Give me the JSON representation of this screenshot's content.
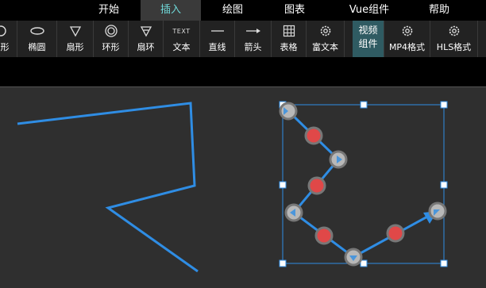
{
  "menu": {
    "tabs": [
      {
        "label": "开始"
      },
      {
        "label": "插入"
      },
      {
        "label": "绘图"
      },
      {
        "label": "图表"
      },
      {
        "label": "Vue组件"
      },
      {
        "label": "帮助"
      }
    ],
    "active_tab": "插入"
  },
  "toolbar": {
    "items": [
      {
        "label": "圆形",
        "icon": "circle-icon"
      },
      {
        "label": "椭圆",
        "icon": "ellipse-icon"
      },
      {
        "label": "扇形",
        "icon": "sector-icon"
      },
      {
        "label": "环形",
        "icon": "ring-icon"
      },
      {
        "label": "扇环",
        "icon": "sector-ring-icon"
      },
      {
        "label": "文本",
        "icon": "text-icon",
        "icon_text": "TEXT"
      },
      {
        "label": "直线",
        "icon": "line-icon"
      },
      {
        "label": "箭头",
        "icon": "arrow-icon"
      },
      {
        "label": "表格",
        "icon": "table-icon"
      },
      {
        "label": "富文本",
        "icon": "gear-icon"
      },
      {
        "label_line1": "视频",
        "label_line2": "组件"
      },
      {
        "label": "MP4格式",
        "icon": "gear-icon"
      },
      {
        "label": "HLS格式",
        "icon": "gear-icon"
      }
    ]
  },
  "colors": {
    "accent": "#2f8de4",
    "active_tab_text": "#6fd6d6",
    "handle_red": "#e04848",
    "handle_gray": "#b8b8b8"
  }
}
